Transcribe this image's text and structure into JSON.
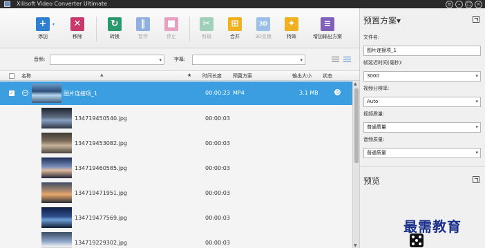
{
  "window": {
    "title": "Xilisoft Video Converter Ultimate",
    "controls": [
      "help",
      "minimize",
      "maximize",
      "close"
    ]
  },
  "toolbar": {
    "buttons": [
      {
        "id": "add",
        "label": "添加",
        "icon": "add-icon",
        "color": "#2f7fd0",
        "enabled": true
      },
      {
        "id": "remove",
        "label": "移除",
        "icon": "remove-icon",
        "color": "#c8386a",
        "enabled": true
      },
      {
        "id": "convert",
        "label": "转换",
        "icon": "convert-icon",
        "color": "#2a9a6c",
        "enabled": true
      },
      {
        "id": "pause",
        "label": "暂停",
        "icon": "pause-icon",
        "color": "#8fb0e0",
        "enabled": false
      },
      {
        "id": "stop",
        "label": "停止",
        "icon": "stop-icon",
        "color": "#e8a0c0",
        "enabled": false
      },
      {
        "id": "clip",
        "label": "剪辑",
        "icon": "scissors-icon",
        "color": "#9fd0b8",
        "enabled": false
      },
      {
        "id": "merge",
        "label": "合并",
        "icon": "merge-icon",
        "color": "#f0b020",
        "enabled": true
      },
      {
        "id": "3d",
        "label": "3D变换",
        "icon": "3d-icon",
        "color": "#9cc0e8",
        "enabled": false
      },
      {
        "id": "effects",
        "label": "特效",
        "icon": "effects-icon",
        "color": "#f0b020",
        "enabled": true
      },
      {
        "id": "add-profile",
        "label": "增加输出方案",
        "icon": "profile-icon",
        "color": "#8060b8",
        "enabled": true
      }
    ]
  },
  "filters": {
    "audio_label": "音频:",
    "audio_value": "",
    "subtitle_label": "字幕:",
    "subtitle_value": ""
  },
  "list": {
    "headers": {
      "name": "名称",
      "star": "★",
      "duration": "时间长度",
      "preset": "预置方案",
      "output_size": "输出大小",
      "status": "状态"
    },
    "group": {
      "checked": true,
      "name": "图片连接项_1",
      "duration": "00:00:23",
      "preset": "MP4",
      "size": "3.1 MB"
    },
    "items": [
      {
        "name": "134719450540.jpg",
        "duration": "00:00:03"
      },
      {
        "name": "134719453082.jpg",
        "duration": "00:00:03"
      },
      {
        "name": "134719460585.jpg",
        "duration": "00:00:03"
      },
      {
        "name": "134719471951.jpg",
        "duration": "00:00:03"
      },
      {
        "name": "134719477569.jpg",
        "duration": "00:00:03"
      },
      {
        "name": "134719229302.jpg",
        "duration": "00:00:03"
      }
    ]
  },
  "right_panel": {
    "title": "预置方案▾",
    "file_name_label": "文件名:",
    "file_name_value": "图片连接项_1",
    "delay_label": "帧延迟时间(毫秒):",
    "delay_value": "3000",
    "resolution_label": "视频分辨率:",
    "resolution_value": "Auto",
    "video_quality_label": "视频质量:",
    "video_quality_value": "普通质量",
    "audio_quality_label": "音频质量:",
    "audio_quality_value": "普通质量",
    "preview_title": "预览"
  },
  "watermark": {
    "text": "最需教育"
  },
  "colors": {
    "selection": "#3a9ee0",
    "watermark": "#1a2f8a"
  }
}
